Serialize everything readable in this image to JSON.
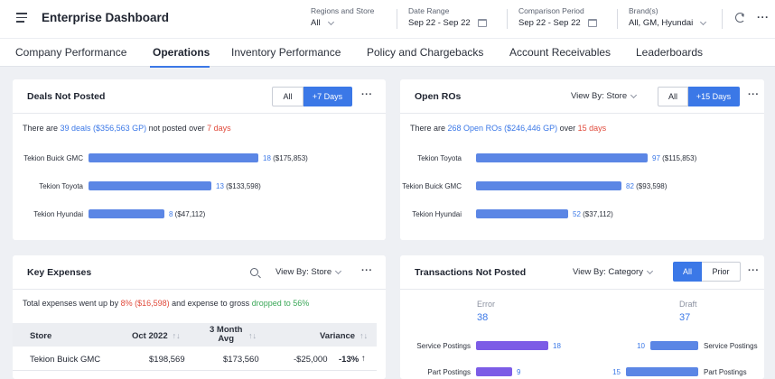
{
  "header": {
    "title": "Enterprise Dashboard",
    "filters": [
      {
        "label": "Regions and Store",
        "value": "All"
      },
      {
        "label": "Date Range",
        "value": "Sep 22  -  Sep 22"
      },
      {
        "label": "Comparison Period",
        "value": "Sep 22  -  Sep 22"
      },
      {
        "label": "Brand(s)",
        "value": "All, GM, Hyundai"
      }
    ],
    "more": "···"
  },
  "tabs": [
    "Company Performance",
    "Operations",
    "Inventory Performance",
    "Policy and Chargebacks",
    "Account Receivables",
    "Leaderboards"
  ],
  "active_tab": "Operations",
  "deals_not_posted": {
    "title": "Deals Not Posted",
    "seg": [
      "All",
      "+7 Days"
    ],
    "summary": {
      "pre": "There are ",
      "highlight": "39 deals ($356,563 GP)",
      "mid": " not posted over ",
      "days": "7 days"
    },
    "rows": [
      {
        "store": "Tekion Buick GMC",
        "count": 18,
        "amount": "($175,853)"
      },
      {
        "store": "Tekion Toyota",
        "count": 13,
        "amount": "($133,598)"
      },
      {
        "store": "Tekion Hyundai",
        "count": 8,
        "amount": "($47,112)"
      }
    ]
  },
  "open_ros": {
    "title": "Open ROs",
    "view_by": "View By: Store",
    "seg": [
      "All",
      "+15 Days"
    ],
    "summary": {
      "pre": "There are ",
      "highlight": "268 Open ROs ($246,446 GP)",
      "mid": " over ",
      "days": "15 days"
    },
    "rows": [
      {
        "store": "Tekion Toyota",
        "count": 97,
        "amount": "($115,853)"
      },
      {
        "store": "Tekion Buick GMC",
        "count": 82,
        "amount": "($93,598)"
      },
      {
        "store": "Tekion Hyundai",
        "count": 52,
        "amount": "($37,112)"
      }
    ]
  },
  "key_expenses": {
    "title": "Key Expenses",
    "view_by": "View By: Store",
    "summary": {
      "pre": "Total expenses went up by ",
      "up": "8% ($16,598)",
      "mid": " and expense to gross ",
      "down": "dropped to 56%"
    },
    "columns": [
      "Store",
      "Oct 2022",
      "3 Month",
      "Avg",
      "Variance"
    ],
    "rows": [
      {
        "store": "Tekion Buick GMC",
        "oct": "$198,569",
        "avg": "$173,560",
        "var": "-$25,000",
        "pct": "-13%"
      }
    ]
  },
  "transactions": {
    "title": "Transactions Not Posted",
    "view_by": "View By: Category",
    "seg": [
      "All",
      "Prior"
    ],
    "error": {
      "label": "Error",
      "value": "38"
    },
    "draft": {
      "label": "Draft",
      "value": "37"
    },
    "rows": [
      {
        "label": "Service Postings",
        "error": 18,
        "draft": 10
      },
      {
        "label": "Part Postings",
        "error": 9,
        "draft": 15
      }
    ]
  },
  "colors": {
    "accent": "#3b78e7",
    "red": "#e04a3b",
    "green": "#3aa757",
    "purple": "#7c5ce6"
  }
}
